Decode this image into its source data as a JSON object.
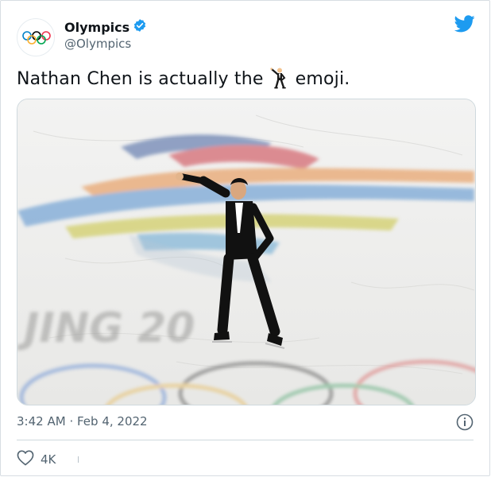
{
  "author": {
    "name": "Olympics",
    "handle": "@Olympics",
    "verified": true,
    "avatar_icon": "olympic-rings-icon"
  },
  "tweet": {
    "text_before": "Nathan Chen is actually the",
    "emoji_icon": "man-dancing-emoji-icon",
    "text_after": "emoji."
  },
  "media": {
    "rink_text": "JING 20"
  },
  "meta": {
    "time": "3:42 AM",
    "separator": "·",
    "date": "Feb 4, 2022"
  },
  "actions": {
    "like_count": "4K"
  },
  "colors": {
    "twitter_blue": "#1d9bf0",
    "verified_blue": "#1d9bf0",
    "text_secondary": "#536471"
  }
}
